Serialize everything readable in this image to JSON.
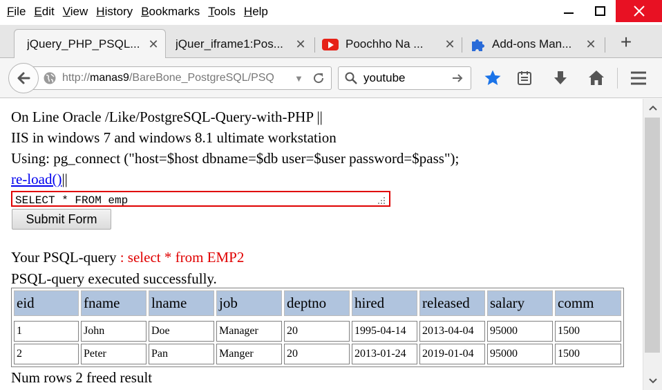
{
  "menu": [
    "File",
    "Edit",
    "View",
    "History",
    "Bookmarks",
    "Tools",
    "Help"
  ],
  "tabs": [
    {
      "label": "jQuery_PHP_PSQL...",
      "active": true
    },
    {
      "label": "jQuer_iframe1:Pos...",
      "active": false
    },
    {
      "label": "Poochho Na ...",
      "active": false,
      "icon": "youtube-icon"
    },
    {
      "label": "Add-ons Man...",
      "active": false,
      "icon": "puzzle-icon"
    }
  ],
  "new_tab_label": "+",
  "close_glyph": "✕",
  "address": {
    "prefix": "http://",
    "host": "manas9",
    "path": "/BareBone_PostgreSQL/PSQ"
  },
  "search": {
    "value": "youtube"
  },
  "page": {
    "line1": "On Line Oracle /Like/PostgreSQL-Query-with-PHP ||",
    "line2": "IIS in windows 7 and windows 8.1 ultimate workstation",
    "line3": "Using: pg_connect (\"host=$host dbname=$db user=$user password=$pass\");",
    "reload_link": "re-load()",
    "reload_suffix": "||",
    "query_value": "SELECT * FROM emp",
    "submit_label": "Submit Form",
    "query_prefix": "Your PSQL-query",
    "query_echo": " : select * from EMP2",
    "success": "PSQL-query executed successfully.",
    "numrows": "Num rows 2 freed result"
  },
  "table": {
    "headers": [
      "eid",
      "fname",
      "lname",
      "job",
      "deptno",
      "hired",
      "released",
      "salary",
      "comm"
    ],
    "rows": [
      [
        "1",
        "John",
        "Doe",
        "Manager",
        "20",
        "1995-04-14",
        "2013-04-04",
        "95000",
        "1500"
      ],
      [
        "2",
        "Peter",
        "Pan",
        "Manger",
        "20",
        "2013-01-24",
        "2019-01-04",
        "95000",
        "1500"
      ]
    ]
  },
  "colors": {
    "accent_close": "#e81123",
    "table_header": "#b0c4de",
    "link": "#0000ee",
    "query_echo": "#e00000",
    "highlight_border": "#e00000"
  }
}
